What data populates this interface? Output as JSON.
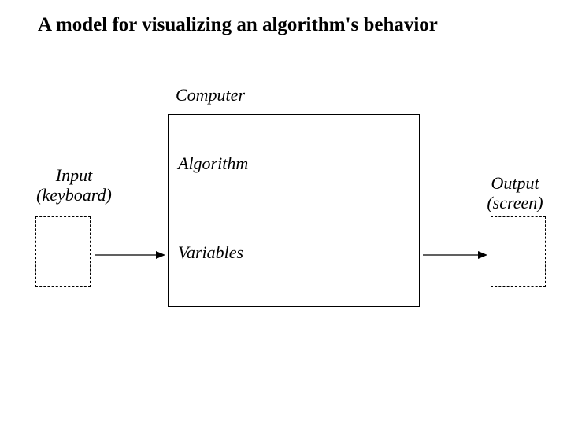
{
  "title": "A model for visualizing an algorithm's behavior",
  "labels": {
    "computer": "Computer",
    "algorithm": "Algorithm",
    "variables": "Variables",
    "input_line1": "Input",
    "input_line2": "(keyboard)",
    "output_line1": "Output",
    "output_line2": "(screen)"
  }
}
